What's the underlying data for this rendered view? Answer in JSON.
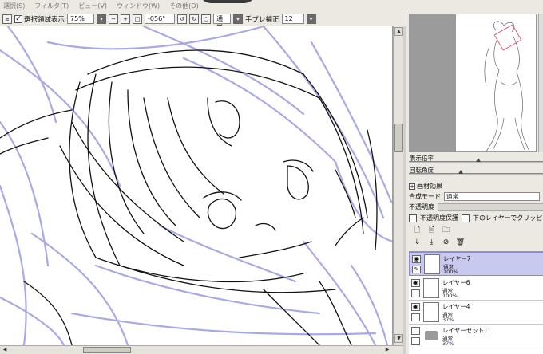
{
  "menu": [
    "選択(S)",
    "フィルタ(T)",
    "ビュー(V)",
    "ウィンドウ(W)",
    "その他(O)"
  ],
  "toolbar": {
    "selection_display_label": "選択領域表示",
    "zoom_value": "75%",
    "rotation_value": "-056°",
    "blend_mode": "通常",
    "stabilizer_label": "手ブレ補正",
    "stabilizer_value": "12"
  },
  "panel": {
    "zoom_label": "表示倍率",
    "rotation_label": "回転角度",
    "texture_effect_label": "画材効果",
    "blend_mode_label": "合成モード",
    "blend_mode_value": "通常",
    "opacity_label": "不透明度",
    "preserve_opacity_label": "不透明度保護",
    "clip_label": "下のレイヤーでクリッピング"
  },
  "layers": [
    {
      "name": "レイヤー7",
      "mode": "通常",
      "opacity": "100%"
    },
    {
      "name": "レイヤー6",
      "mode": "通常",
      "opacity": "100%"
    },
    {
      "name": "レイヤー4",
      "mode": "通常",
      "opacity": "37%"
    },
    {
      "name": "レイヤーセット1",
      "mode": "通常",
      "opacity": "37%"
    }
  ],
  "colors": {
    "sketch_blue": "#a9a9e6",
    "line_black": "#111111",
    "selected_layer": "#c9c9ef"
  }
}
